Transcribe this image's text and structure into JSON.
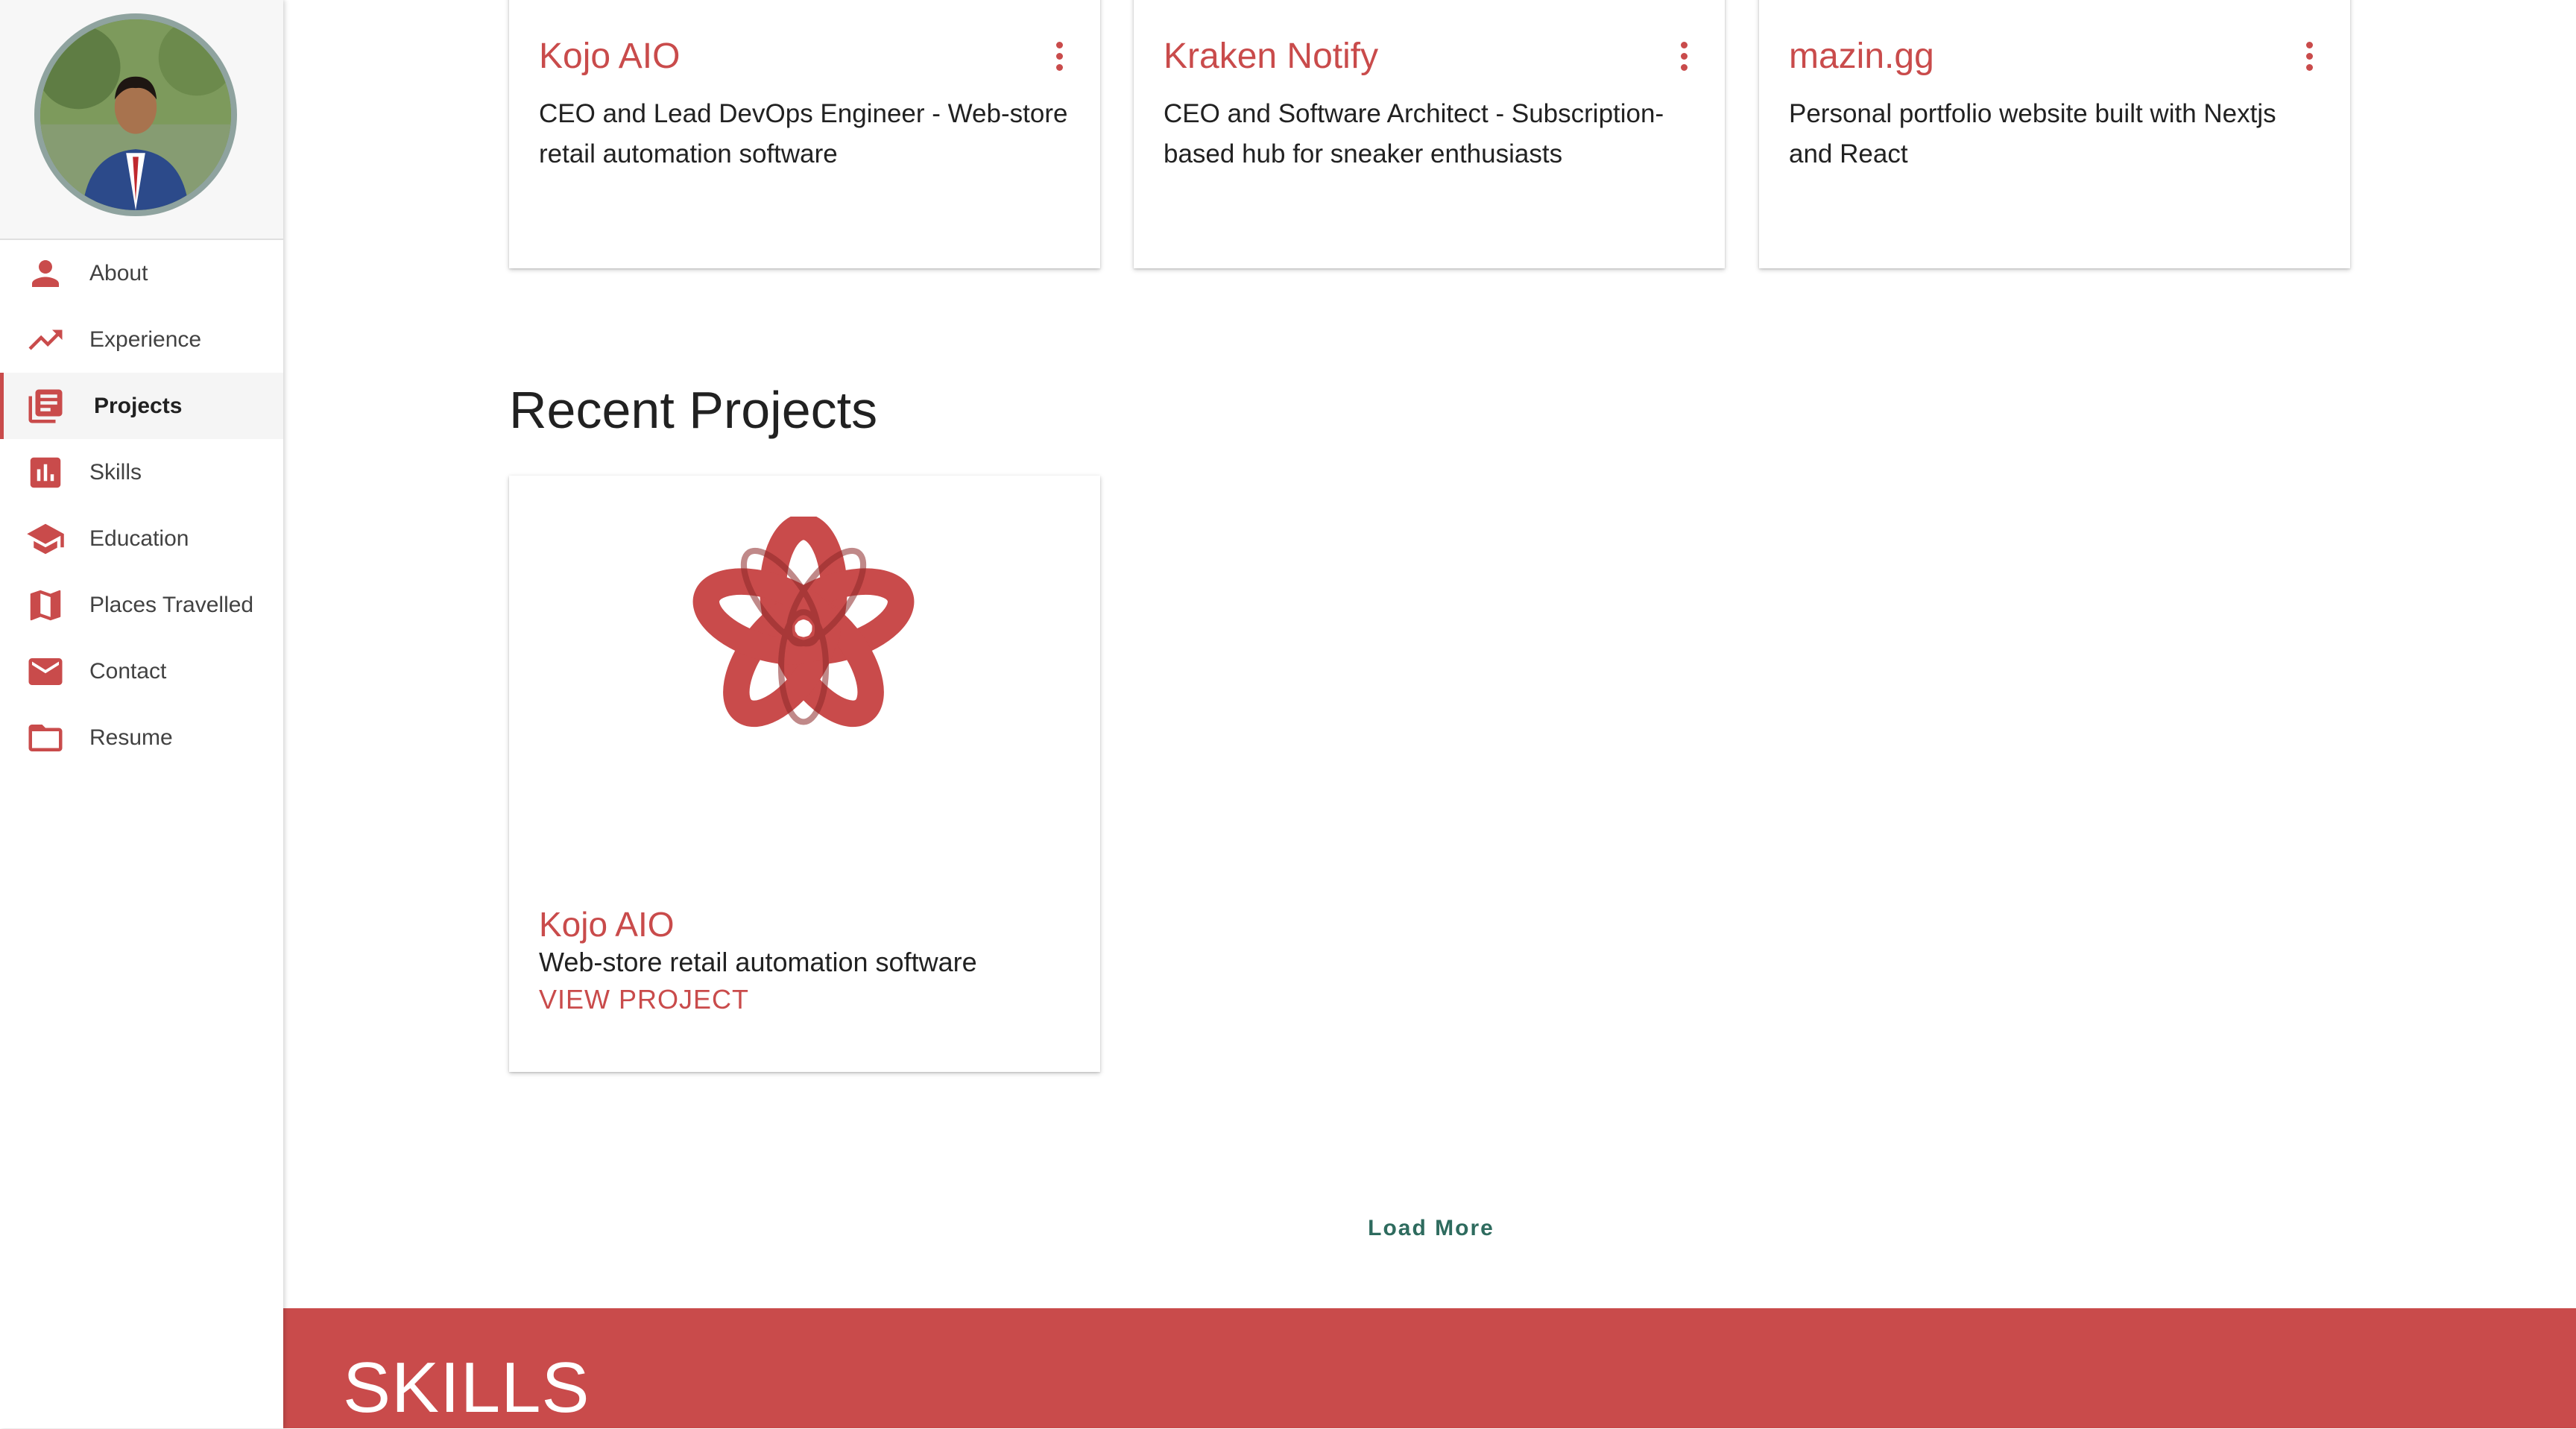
{
  "sidebar": {
    "items": [
      {
        "label": "About",
        "icon": "person-icon"
      },
      {
        "label": "Experience",
        "icon": "trending-up-icon"
      },
      {
        "label": "Projects",
        "icon": "library-books-icon",
        "active": true
      },
      {
        "label": "Skills",
        "icon": "bar-chart-icon"
      },
      {
        "label": "Education",
        "icon": "school-icon"
      },
      {
        "label": "Places Travelled",
        "icon": "map-icon"
      },
      {
        "label": "Contact",
        "icon": "mail-icon"
      },
      {
        "label": "Resume",
        "icon": "folder-icon"
      }
    ]
  },
  "experience_cards": [
    {
      "title": "Kojo AIO",
      "description": "CEO and Lead DevOps Engineer - Web-store retail automation software"
    },
    {
      "title": "Kraken Notify",
      "description": "CEO and Software Architect - Subscription-based hub for sneaker enthusiasts"
    },
    {
      "title": "mazin.gg",
      "description": "Personal portfolio website built with Nextjs and React"
    }
  ],
  "recent_projects": {
    "heading": "Recent Projects",
    "items": [
      {
        "title": "Kojo AIO",
        "description": "Web-store retail automation software",
        "link_label": "VIEW PROJECT"
      }
    ]
  },
  "load_more_label": "Load More",
  "skills_section": {
    "title": "SKILLS"
  },
  "colors": {
    "accent": "#c94b4b",
    "load_more": "#2e6b5e",
    "text": "#212121"
  }
}
